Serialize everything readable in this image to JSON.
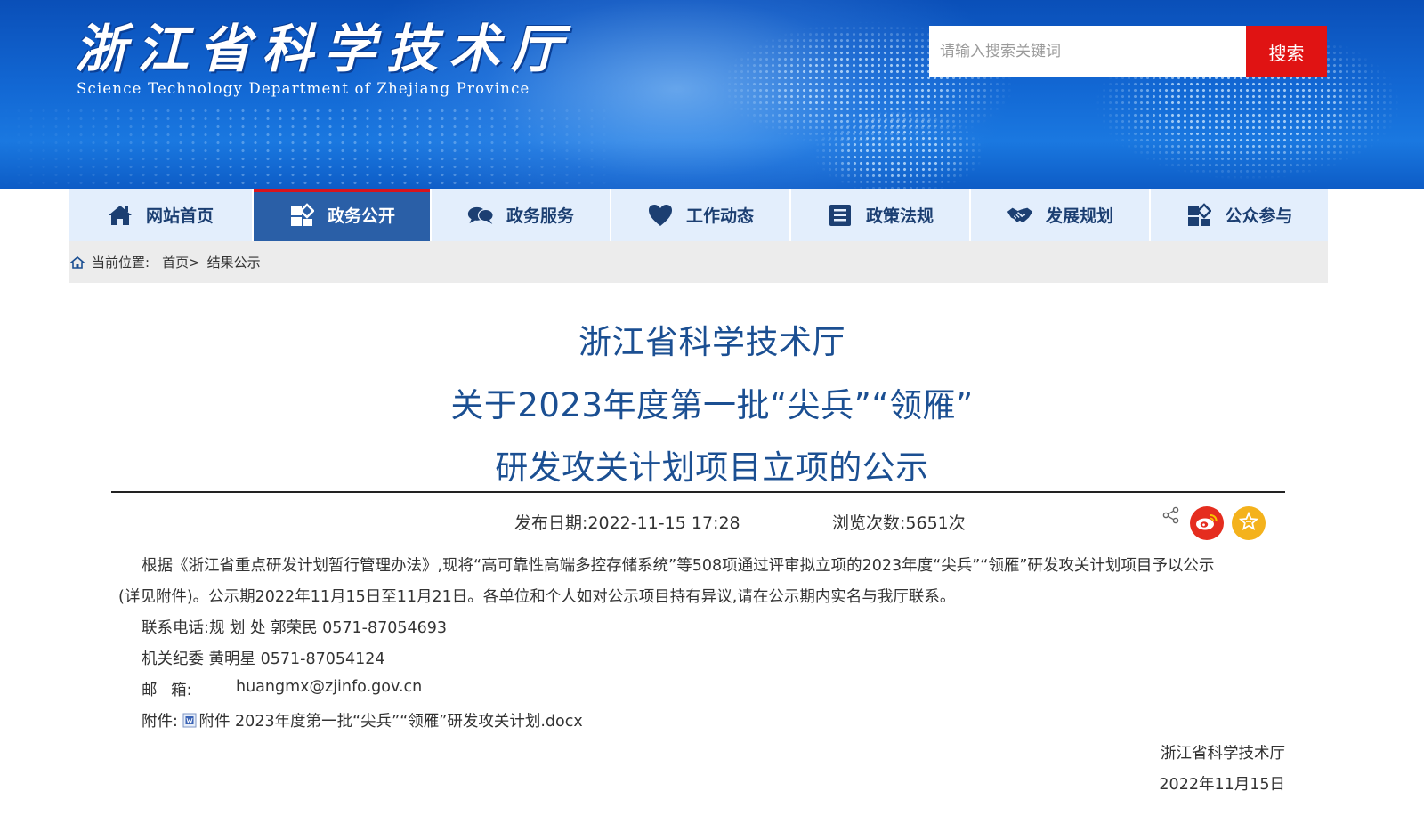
{
  "header": {
    "logo_cn": "浙江省科学技术厅",
    "logo_en": "Science Technology Department of Zhejiang Province",
    "search_placeholder": "请输入搜索关键词",
    "search_button": "搜索"
  },
  "nav": {
    "items": [
      {
        "label": "网站首页",
        "icon": "home-icon",
        "active": false
      },
      {
        "label": "政务公开",
        "icon": "open-affairs-icon",
        "active": true
      },
      {
        "label": "政务服务",
        "icon": "chat-bubbles-icon",
        "active": false
      },
      {
        "label": "工作动态",
        "icon": "heart-icon",
        "active": false
      },
      {
        "label": "政策法规",
        "icon": "document-list-icon",
        "active": false
      },
      {
        "label": "发展规划",
        "icon": "handshake-icon",
        "active": false
      },
      {
        "label": "公众参与",
        "icon": "public-participation-icon",
        "active": false
      }
    ]
  },
  "breadcrumb": {
    "prefix": "当前位置:",
    "home": "首页>",
    "current": "结果公示"
  },
  "article": {
    "title_lines": [
      "浙江省科学技术厅",
      "关于2023年度第一批“尖兵”“领雁”",
      "研发攻关计划项目立项的公示"
    ],
    "publish_date": "发布日期:2022-11-15 17:28",
    "views": "浏览次数:5651次",
    "paragraph_line1": "根据《浙江省重点研发计划暂行管理办法》,现将“高可靠性高端多控存储系统”等508项通过评审拟立项的2023年度“尖兵”“领雁”研发攻关计划项目予以公示",
    "paragraph_line2": "(详见附件)。公示期2022年11月15日至11月21日。各单位和个人如对公示项目持有异议,请在公示期内实名与我厅联系。",
    "contact_phone": "联系电话:规 划 处 郭荣民 0571-87054693",
    "contact_discipline": "机关纪委 黄明星 0571-87054124",
    "email_label": "邮 箱:",
    "email": "huangmx@zjinfo.gov.cn",
    "attachment_label": "附件:",
    "attachment_file": "附件 2023年度第一批“尖兵”“领雁”研发攻关计划.docx",
    "signature_org": "浙江省科学技术厅",
    "signature_date": "2022年11月15日"
  },
  "colors": {
    "banner_blue": "#1267d3",
    "nav_bg": "#e3eefc",
    "nav_active": "#2a5fa7",
    "accent_red": "#e01313",
    "title_blue": "#1b4f92",
    "weibo_red": "#e52d1f",
    "fav_yellow": "#f4b21c"
  }
}
